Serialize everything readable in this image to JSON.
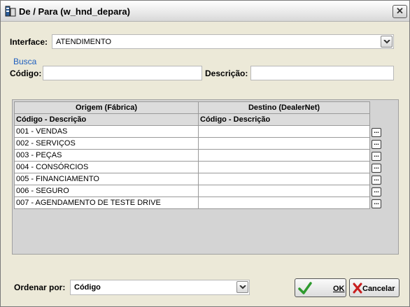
{
  "window": {
    "title": "De / Para (w_hnd_depara)",
    "close_glyph": "✕"
  },
  "interface": {
    "label": "Interface:",
    "selected": "ATENDIMENTO"
  },
  "busca": {
    "heading": "Busca",
    "codigo_label": "Código:",
    "codigo_value": "",
    "descricao_label": "Descrição:",
    "descricao_value": ""
  },
  "grid": {
    "group_headers": [
      "Origem (Fábrica)",
      "Destino (DealerNet)"
    ],
    "sub_headers": [
      "Código - Descrição",
      "Código - Descrição"
    ],
    "rows": [
      {
        "origem": "001 - VENDAS",
        "destino": ""
      },
      {
        "origem": "002 - SERVIÇOS",
        "destino": ""
      },
      {
        "origem": "003 - PEÇAS",
        "destino": ""
      },
      {
        "origem": "004 - CONSÓRCIOS",
        "destino": ""
      },
      {
        "origem": "005 - FINANCIAMENTO",
        "destino": ""
      },
      {
        "origem": "006 - SEGURO",
        "destino": ""
      },
      {
        "origem": "007 - AGENDAMENTO DE TESTE DRIVE",
        "destino": ""
      }
    ],
    "row_button_glyph": "..."
  },
  "footer": {
    "ordenar_label": "Ordenar por:",
    "ordenar_selected": "Código",
    "ok_label": "OK",
    "cancelar_label": "Cancelar"
  },
  "colors": {
    "accent": "#1f5fbf",
    "ok_check": "#2e9a2e",
    "cancel_x": "#c81e1e"
  }
}
